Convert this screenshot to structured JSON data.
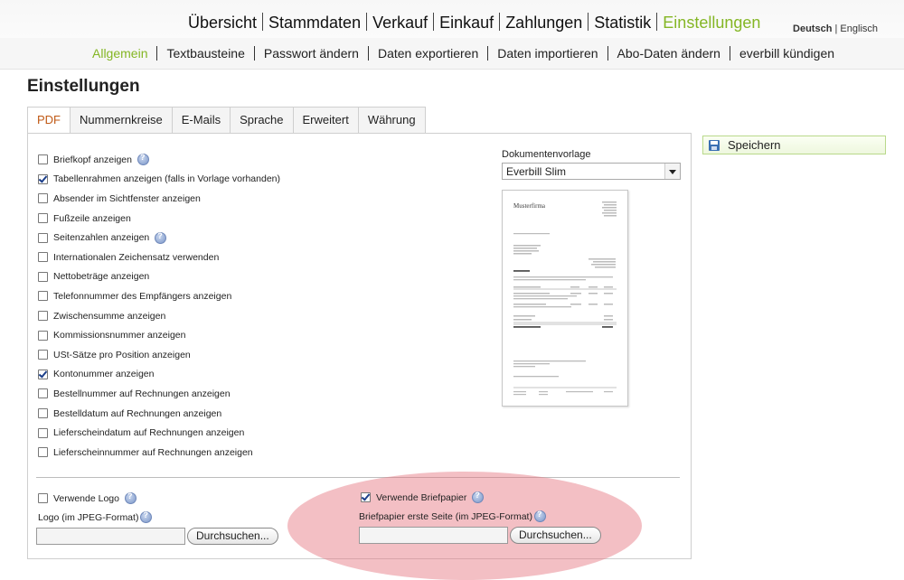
{
  "topnav": {
    "items": [
      "Übersicht",
      "Stammdaten",
      "Verkauf",
      "Einkauf",
      "Zahlungen",
      "Statistik",
      "Einstellungen"
    ],
    "active_index": 6,
    "active_color": "#84b624"
  },
  "language": {
    "current": "Deutsch",
    "separator": "|",
    "other": "Englisch"
  },
  "subnav": {
    "items": [
      "Allgemein",
      "Textbausteine",
      "Passwort ändern",
      "Daten exportieren",
      "Daten importieren",
      "Abo-Daten ändern",
      "everbill kündigen"
    ],
    "active_index": 0
  },
  "page_title": "Einstellungen",
  "tabs": [
    "PDF",
    "Nummernkreise",
    "E-Mails",
    "Sprache",
    "Erweitert",
    "Währung"
  ],
  "active_tab": "PDF",
  "options": [
    {
      "label": "Briefkopf anzeigen",
      "checked": false,
      "help": true
    },
    {
      "label": "Tabellenrahmen anzeigen (falls in Vorlage vorhanden)",
      "checked": true,
      "help": false
    },
    {
      "label": "Absender im Sichtfenster anzeigen",
      "checked": false,
      "help": false
    },
    {
      "label": "Fußzeile anzeigen",
      "checked": false,
      "help": false
    },
    {
      "label": "Seitenzahlen anzeigen",
      "checked": false,
      "help": true
    },
    {
      "label": "Internationalen Zeichensatz verwenden",
      "checked": false,
      "help": false
    },
    {
      "label": "Nettobeträge anzeigen",
      "checked": false,
      "help": false
    },
    {
      "label": "Telefonnummer des Empfängers anzeigen",
      "checked": false,
      "help": false
    },
    {
      "label": "Zwischensumme anzeigen",
      "checked": false,
      "help": false
    },
    {
      "label": "Kommissionsnummer anzeigen",
      "checked": false,
      "help": false
    },
    {
      "label": "USt-Sätze pro Position anzeigen",
      "checked": false,
      "help": false
    },
    {
      "label": "Kontonummer anzeigen",
      "checked": true,
      "help": false
    },
    {
      "label": "Bestellnummer auf Rechnungen anzeigen",
      "checked": false,
      "help": false
    },
    {
      "label": "Bestelldatum auf Rechnungen anzeigen",
      "checked": false,
      "help": false
    },
    {
      "label": "Lieferscheindatum auf Rechnungen anzeigen",
      "checked": false,
      "help": false
    },
    {
      "label": "Lieferscheinnummer auf Rechnungen anzeigen",
      "checked": false,
      "help": false
    }
  ],
  "template": {
    "label": "Dokumentenvorlage",
    "selected": "Everbill Slim"
  },
  "save_label": "Speichern",
  "logo": {
    "checkbox_label": "Verwende Logo",
    "checked": false,
    "field_label": "Logo (im JPEG-Format)",
    "browse_label": "Durchsuchen..."
  },
  "letterhead": {
    "checkbox_label": "Verwende Briefpapier",
    "checked": true,
    "field_label": "Briefpapier erste Seite (im JPEG-Format)",
    "browse_label": "Durchsuchen..."
  }
}
